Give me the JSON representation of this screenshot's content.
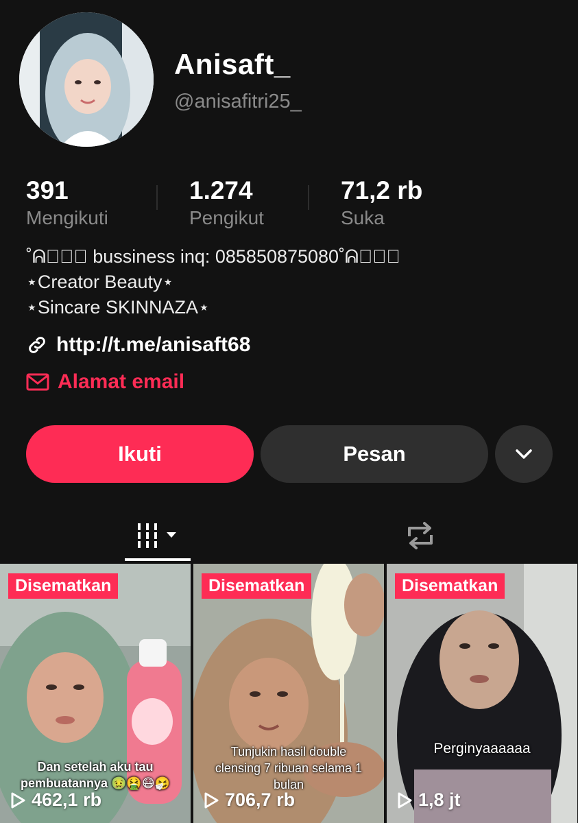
{
  "profile": {
    "display_name": "Anisaft_",
    "username": "@anisafitri25_"
  },
  "stats": [
    {
      "value": "391",
      "label": "Mengikuti"
    },
    {
      "value": "1.274",
      "label": "Pengikut"
    },
    {
      "value": "71,2 rb",
      "label": "Suka"
    }
  ],
  "bio": [
    "˚ᕱ⑅ᕱ゚ bussiness inq: 085850875080˚ᕱ⑅ᕱ゚",
    "⋆Creator Beauty⋆",
    "⋆Sincare SKINNAZA⋆"
  ],
  "link": {
    "text": "http://t.me/anisaft68",
    "icon": "link-icon"
  },
  "email": {
    "text": "Alamat email",
    "icon": "mail-icon"
  },
  "actions": {
    "follow_label": "Ikuti",
    "message_label": "Pesan",
    "more_icon": "chevron-down-icon"
  },
  "tabs": [
    {
      "icon": "grid-icon",
      "active": true
    },
    {
      "icon": "repost-icon",
      "active": false
    }
  ],
  "videos": [
    {
      "badge": "Disematkan",
      "views": "462,1 rb",
      "caption": "Dan setelah aku tau pembuatannya 🤢🤮😷🤧"
    },
    {
      "badge": "Disematkan",
      "views": "706,7 rb",
      "caption": "Tunjukin hasil double clensing 7 ribuan selama 1 bulan"
    },
    {
      "badge": "Disematkan",
      "views": "1,8 jt",
      "caption": "Perginyaaaaaa"
    }
  ],
  "colors": {
    "background": "#121212",
    "accent": "#fe2c55",
    "secondary_button": "#2f2f2f",
    "muted_text": "#8a8a8a"
  }
}
